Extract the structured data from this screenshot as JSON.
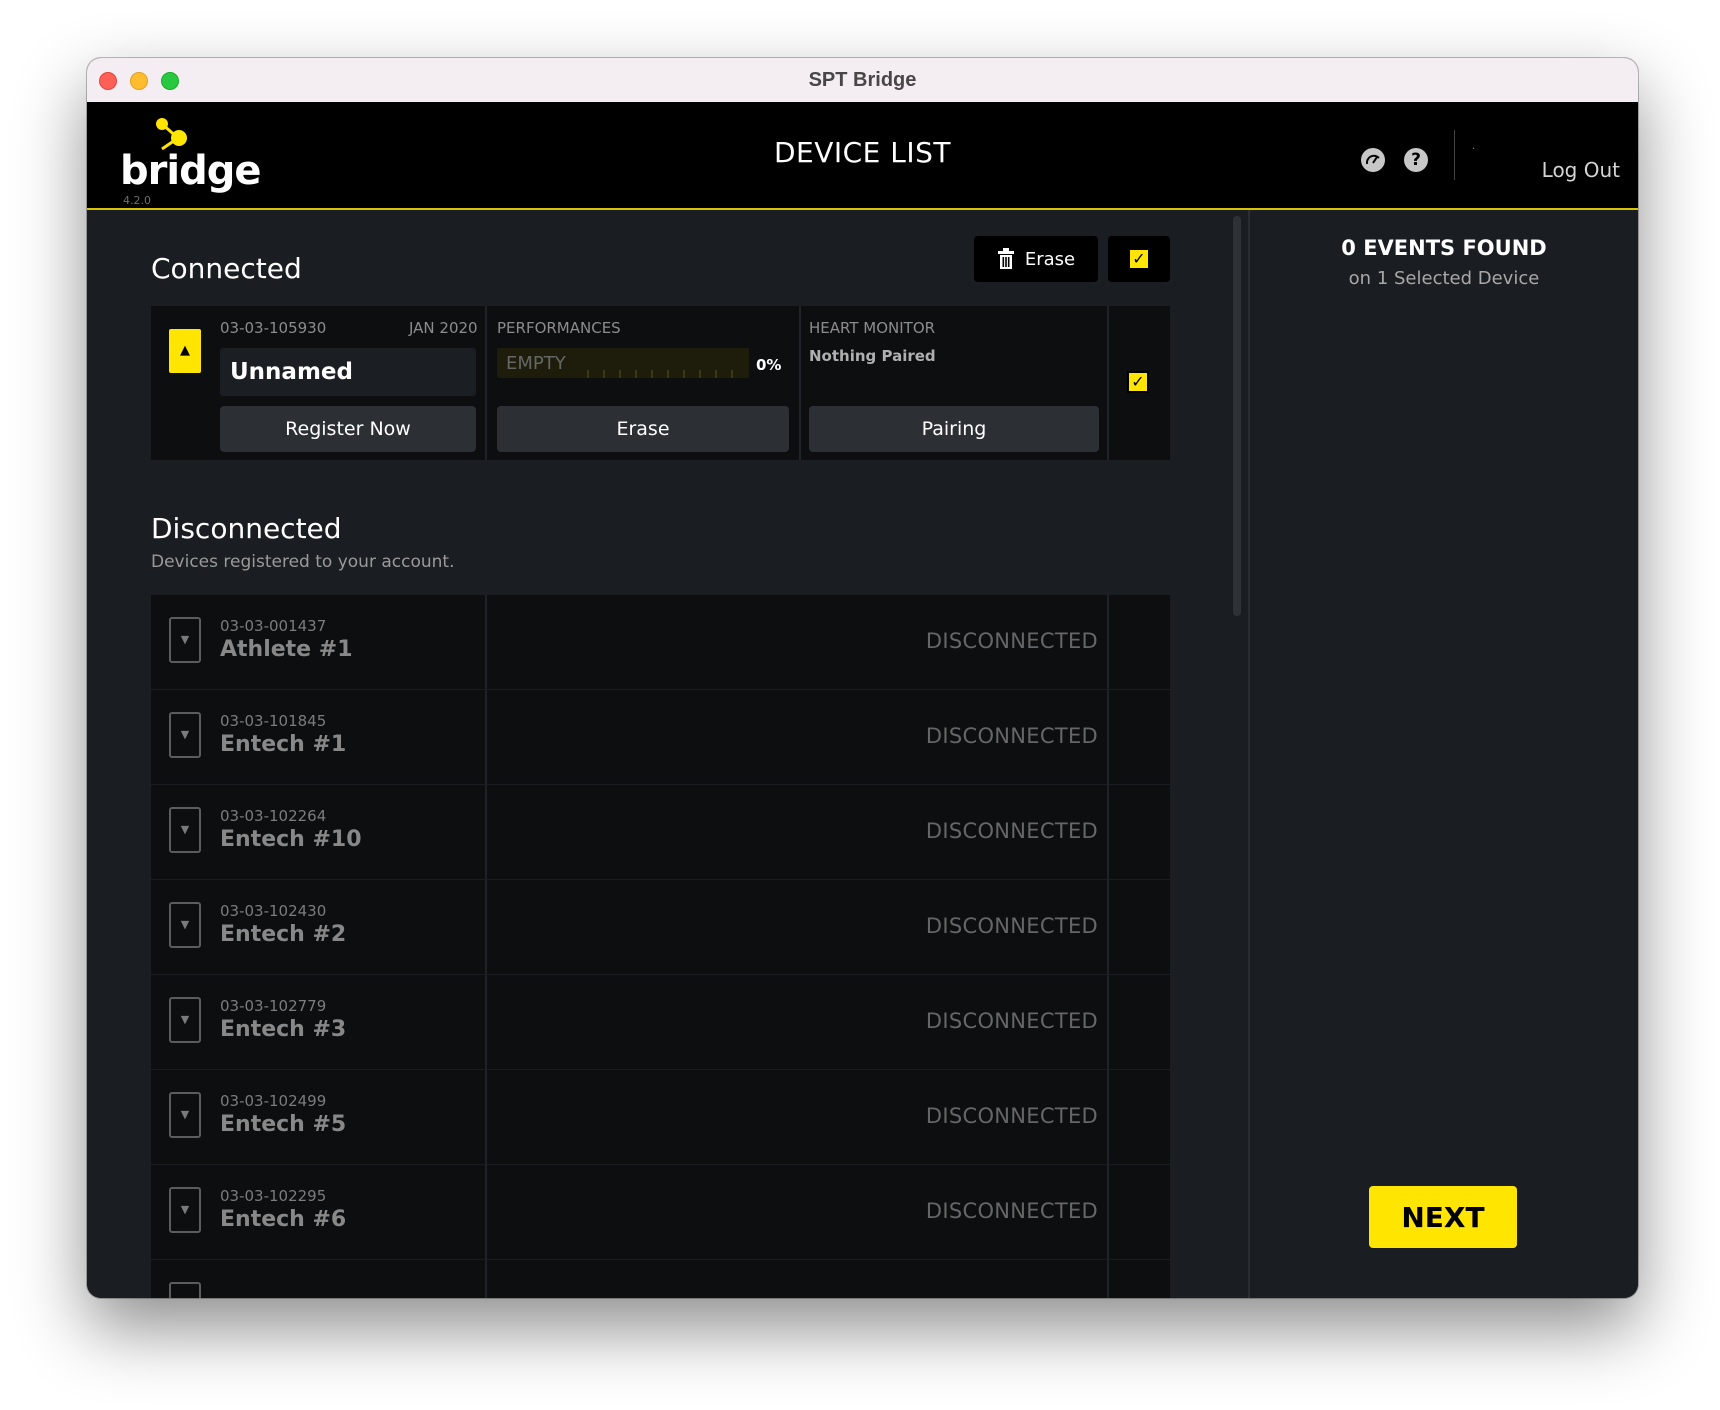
{
  "window": {
    "title": "SPT Bridge"
  },
  "app": {
    "logo_text": "bridge",
    "version": "4.2.0",
    "page_title": "DEVICE LIST",
    "logout_label": "Log Out"
  },
  "header_icons": [
    "gauge-icon",
    "help-icon"
  ],
  "connected": {
    "title": "Connected",
    "erase_label": "Erase",
    "select_all_checked": true,
    "device": {
      "id": "03-03-105930",
      "date": "JAN 2020",
      "name": "Unnamed",
      "register_label": "Register Now",
      "performances_label": "PERFORMANCES",
      "performances_value": "EMPTY",
      "performances_fill": 0,
      "performances_percent": "0%",
      "erase_label": "Erase",
      "heart_monitor_label": "HEART MONITOR",
      "heart_monitor_value": "Nothing Paired",
      "pairing_label": "Pairing",
      "selected": true
    }
  },
  "disconnected": {
    "title": "Disconnected",
    "subtitle": "Devices registered to your account.",
    "devices": [
      {
        "id": "03-03-001437",
        "name": "Athlete #1",
        "status": "DISCONNECTED"
      },
      {
        "id": "03-03-101845",
        "name": "Entech #1",
        "status": "DISCONNECTED"
      },
      {
        "id": "03-03-102264",
        "name": "Entech #10",
        "status": "DISCONNECTED"
      },
      {
        "id": "03-03-102430",
        "name": "Entech #2",
        "status": "DISCONNECTED"
      },
      {
        "id": "03-03-102779",
        "name": "Entech #3",
        "status": "DISCONNECTED"
      },
      {
        "id": "03-03-102499",
        "name": "Entech #5",
        "status": "DISCONNECTED"
      },
      {
        "id": "03-03-102295",
        "name": "Entech #6",
        "status": "DISCONNECTED"
      }
    ]
  },
  "sidebar": {
    "events_title": "0 EVENTS FOUND",
    "events_subtitle": "on 1 Selected Device",
    "next_label": "NEXT"
  },
  "colors": {
    "accent": "#ffe500",
    "background": "#1a1d21",
    "header": "#000000"
  }
}
